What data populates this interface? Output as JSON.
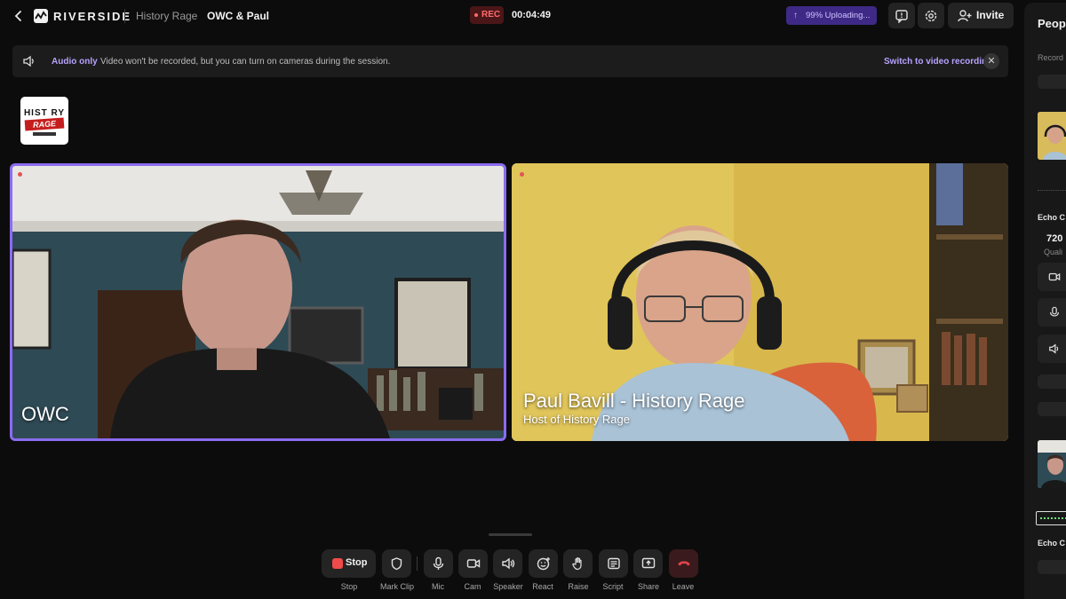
{
  "header": {
    "brand": "RIVERSIDE",
    "studio": "History Rage",
    "session": "OWC & Paul",
    "rec_label": "REC",
    "timer": "00:04:49",
    "upload_status": "99% Uploading...",
    "invite_label": "Invite"
  },
  "banner": {
    "title": "Audio only",
    "message": "Video won't be recorded, but you can turn on cameras during the session.",
    "link": "Switch to video recording",
    "close": "✕"
  },
  "show_logo": {
    "top": "HIST RY",
    "middle": "RAGE"
  },
  "participants": [
    {
      "name": "OWC",
      "subtitle": ""
    },
    {
      "name": "Paul Bavill - History Rage",
      "subtitle": "Host of History Rage"
    }
  ],
  "toolbar": {
    "stop_button": "Stop",
    "labels": [
      "Stop",
      "Mark Clip",
      "Mic",
      "Cam",
      "Speaker",
      "React",
      "Raise",
      "Script",
      "Share",
      "Leave"
    ]
  },
  "side_panel": {
    "title": "People",
    "recording_label": "Record",
    "echo_label_1": "Echo C",
    "quality_value": "720",
    "quality_label": "Quali",
    "echo_label_2": "Echo C"
  },
  "colors": {
    "accent": "#8b6cf0",
    "rec_red": "#ff6b6b",
    "upload_bg": "#3e2a86",
    "leave_red": "#e0444a"
  }
}
